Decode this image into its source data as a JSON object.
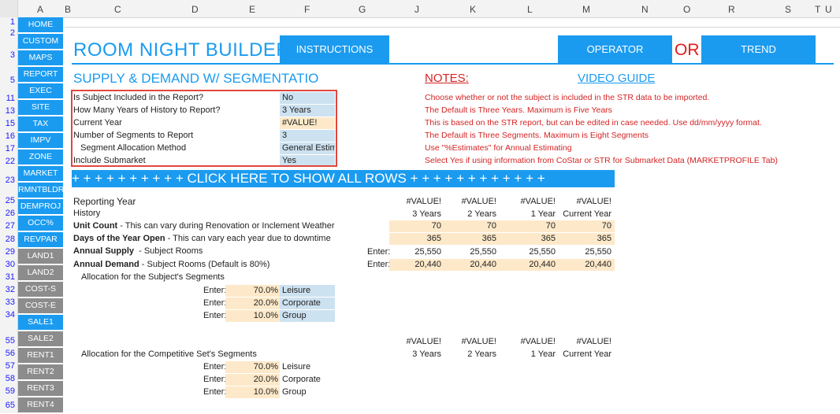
{
  "columns": [
    "A",
    "B",
    "C",
    "D",
    "E",
    "F",
    "G",
    "J",
    "K",
    "L",
    "M",
    "N",
    "O",
    "R",
    "S",
    "T",
    "U"
  ],
  "rows": [
    "1",
    "2",
    "3",
    "5",
    "11",
    "13",
    "15",
    "16",
    "17",
    "22",
    "23",
    "25",
    "26",
    "27",
    "28",
    "29",
    "30",
    "31",
    "32",
    "33",
    "34",
    "55",
    "56",
    "57",
    "58",
    "59",
    "65"
  ],
  "nav": [
    {
      "label": "HOME",
      "gray": false
    },
    {
      "label": "CUSTOM",
      "gray": false
    },
    {
      "label": "MAPS",
      "gray": false
    },
    {
      "label": "REPORT",
      "gray": false
    },
    {
      "label": "EXEC",
      "gray": false
    },
    {
      "label": "SITE",
      "gray": false
    },
    {
      "label": "TAX",
      "gray": false
    },
    {
      "label": "IMPV",
      "gray": false
    },
    {
      "label": "ZONE",
      "gray": false
    },
    {
      "label": "MARKET",
      "gray": false
    },
    {
      "label": "RMNTBLDR",
      "gray": false
    },
    {
      "label": "DEMPROJ",
      "gray": false
    },
    {
      "label": "OCC%",
      "gray": false
    },
    {
      "label": "REVPAR",
      "gray": false
    },
    {
      "label": "LAND1",
      "gray": true
    },
    {
      "label": "LAND2",
      "gray": true
    },
    {
      "label": "COST-S",
      "gray": true
    },
    {
      "label": "COST-E",
      "gray": true
    },
    {
      "label": "SALE1",
      "gray": false
    },
    {
      "label": "SALE2",
      "gray": true
    },
    {
      "label": "RENT1",
      "gray": true
    },
    {
      "label": "RENT2",
      "gray": true
    },
    {
      "label": "RENT3",
      "gray": true
    },
    {
      "label": "RENT4",
      "gray": true
    }
  ],
  "header": {
    "title": "ROOM NIGHT BUILDER",
    "instructions_label": "INSTRUCTIONS",
    "operator_label": "OPERATOR",
    "or_text": "OR",
    "trend_label": "TREND",
    "subtitle": "SUPPLY & DEMAND W/ SEGMENTATIO",
    "notes_label": "NOTES:",
    "video_guide_label": "VIDEO GUIDE"
  },
  "settings": [
    {
      "label": "Is Subject Included in the Report?",
      "value": "No",
      "note": "Choose whether or not the subject is included in the STR data to be imported."
    },
    {
      "label": "How Many Years of History to Report?",
      "value": "3 Years",
      "note": "The Default is Three Years. Maximum is Five Years"
    },
    {
      "label": "Current Year",
      "value": "#VALUE!",
      "note": "This is based on the STR report, but can be edited in case needed. Use dd/mm/yyyy format."
    },
    {
      "label": "Number of Segments to Report",
      "value": "3",
      "note": "The Default is Three Segments. Maximum is Eight Segments"
    },
    {
      "label": "   Segment Allocation Method",
      "value": "General Estima",
      "note": "Use \"%Estimates\" for Annual Estimating"
    },
    {
      "label": "Include Submarket",
      "value": "Yes",
      "note": "Select Yes if using information from CoStar or STR for Submarket Data (MARKETPROFILE Tab)"
    }
  ],
  "banner": "+ + + + + + + + + + CLICK HERE TO SHOW ALL ROWS + + + + + + + + + + + +",
  "reporting": {
    "reporting_year_label": "Reporting Year",
    "history_label": "History",
    "years": [
      "#VALUE!",
      "#VALUE!",
      "#VALUE!",
      "#VALUE!"
    ],
    "year_labels": [
      "3 Years",
      "2 Years",
      "1 Year",
      "Current Year"
    ],
    "unit_count": {
      "bold": "Unit Count",
      "rest": " - This can vary during Renovation or Inclement Weather",
      "values": [
        "70",
        "70",
        "70",
        "70"
      ]
    },
    "days_open": {
      "bold": "Days of the Year Open",
      "rest": " - This can vary each year due to downtime",
      "values": [
        "365",
        "365",
        "365",
        "365"
      ]
    },
    "annual_supply": {
      "bold": "Annual Supply",
      "rest": "  - Subject Rooms",
      "enter": "Enter:",
      "values": [
        "25,550",
        "25,550",
        "25,550",
        "25,550"
      ]
    },
    "annual_demand": {
      "bold": "Annual Demand",
      "rest": " - Subject Rooms (Default is 80%)",
      "enter": "Enter:",
      "values": [
        "20,440",
        "20,440",
        "20,440",
        "20,440"
      ]
    }
  },
  "subject_allocation": {
    "title": "Allocation for the Subject's Segments",
    "rows": [
      {
        "enter": "Enter:",
        "pct": "70.0%",
        "name": "Leisure"
      },
      {
        "enter": "Enter:",
        "pct": "20.0%",
        "name": "Corporate"
      },
      {
        "enter": "Enter:",
        "pct": "10.0%",
        "name": "Group"
      }
    ]
  },
  "comp_years": [
    "#VALUE!",
    "#VALUE!",
    "#VALUE!",
    "#VALUE!"
  ],
  "comp_year_labels": [
    "3 Years",
    "2 Years",
    "1 Year",
    "Current Year"
  ],
  "comp_allocation": {
    "title": "Allocation for the Competitive Set's Segments",
    "rows": [
      {
        "enter": "Enter:",
        "pct": "70.0%",
        "name": "Leisure"
      },
      {
        "enter": "Enter:",
        "pct": "20.0%",
        "name": "Corporate"
      },
      {
        "enter": "Enter:",
        "pct": "10.0%",
        "name": "Group"
      }
    ]
  },
  "colors": {
    "accent": "#1a9bf0",
    "note_red": "#d42424",
    "input_orange": "#fde9c9",
    "input_blue": "#cde2f0",
    "nav_gray": "#8c8c8c"
  }
}
